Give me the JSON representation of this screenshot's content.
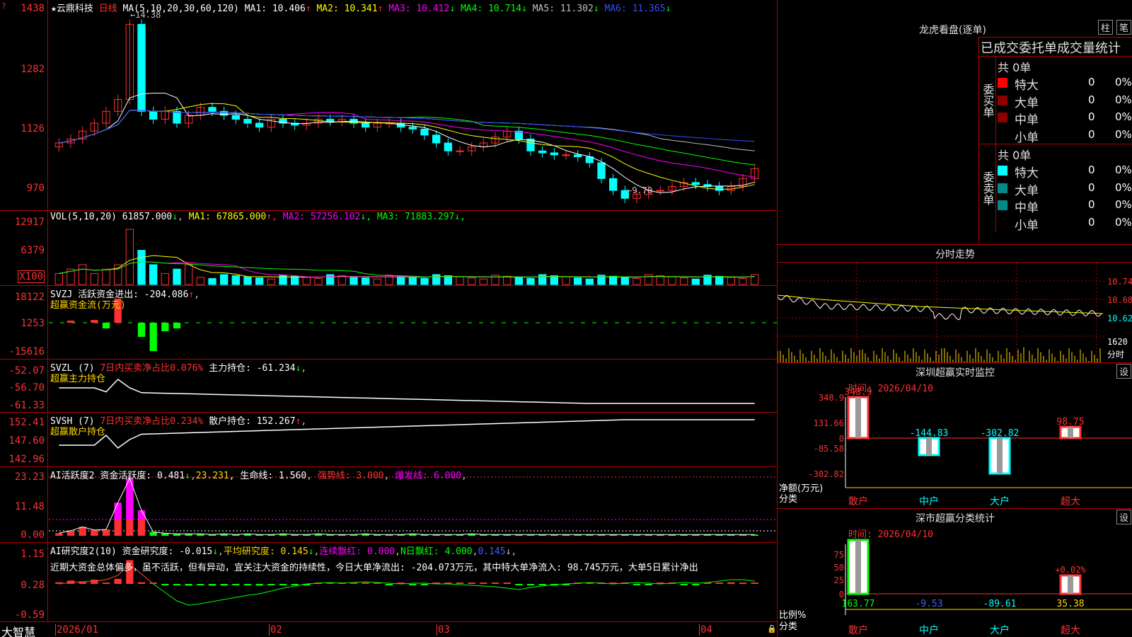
{
  "stock": {
    "name": "云鼎科技",
    "period": "日线",
    "ma_title": "MA(5,10,20,30,60,120)",
    "mas": [
      {
        "label": "MA1: 10.406",
        "arrow": "↑",
        "color": "#ffffff"
      },
      {
        "label": "MA2: 10.341",
        "arrow": "↑",
        "color": "#ffff00"
      },
      {
        "label": "MA3: 10.412",
        "arrow": "↓",
        "color": "#ff00ff"
      },
      {
        "label": "MA4: 10.714",
        "arrow": "↓",
        "color": "#00ff00"
      },
      {
        "label": "MA5: 11.302",
        "arrow": "↓",
        "color": "#c0c0c0"
      },
      {
        "label": "MA6: 11.365",
        "arrow": "↓",
        "color": "#3050ff"
      }
    ],
    "high_mark": "14.38",
    "low_mark": "9.70",
    "price_axis": [
      "1438",
      "1282",
      "1126",
      "970"
    ]
  },
  "vol": {
    "title": "VOL(5,10,20)",
    "value": "61857.000",
    "arrow": "↓",
    "mas": [
      {
        "label": "MA1: 67865.000",
        "arrow": "↑",
        "color": "#ffff00"
      },
      {
        "label": "MA2: 57256.102",
        "arrow": "↓",
        "color": "#ff00ff"
      },
      {
        "label": "MA3: 71883.297",
        "arrow": "↓",
        "color": "#00ff00"
      }
    ],
    "axis": [
      "12917",
      "6379"
    ],
    "unit": "X100"
  },
  "svzj": {
    "title": "SVZJ",
    "text": "活跃资金进出: -204.086",
    "arrow": "↑",
    "sub": "超赢资金流(万元)",
    "axis": [
      "18122",
      "1253",
      "-15616"
    ]
  },
  "svzl": {
    "title": "SVZL (7)",
    "ratio": "7日内买卖净占比0.076%",
    "hold": "主力持仓: -61.234",
    "arrow": "↓",
    "sub": "超赢主力持仓",
    "axis": [
      "-52.07",
      "-56.70",
      "-61.33"
    ]
  },
  "svsh": {
    "title": "SVSH (7)",
    "ratio": "7日内买卖净占比0.234%",
    "hold": "散户持仓: 152.267",
    "arrow": "↑",
    "sub": "超赢散户持仓",
    "axis": [
      "152.41",
      "147.60",
      "142.96"
    ]
  },
  "ai1": {
    "title": "AI活跃度2",
    "a": "资金活跃度: 0.481",
    "a_arrow": "↓",
    "b": "23.231",
    "b_arrow": ",",
    "c": "生命线: 1.560",
    "d": "强势线: 3.000",
    "e": "爆发线: 6.000",
    "axis": [
      "23.23",
      "11.48",
      "0.00"
    ]
  },
  "ai2": {
    "title": "AI研究度2(10)",
    "a": "资金研究度: -0.015",
    "a_arrow": "↓",
    "b": "平均研究度: 0.145",
    "b_arrow": "↓",
    "c": "连续飘红: 0.000",
    "d": "N日飘红: 4.000",
    "e": "0.145",
    "note": "近期大资金总体偏多，虽不活跃，但有异动，宜关注大资金的持续性，今日大单净流出: -204.073万元，其中特大单净流入: 98.745万元，大单5日累计净出",
    "axis": [
      "1.15",
      "0.28",
      "-0.59"
    ]
  },
  "dates": {
    "bottom_label": "大智慧",
    "labels": [
      "2026/01",
      "02",
      "03",
      "04"
    ]
  },
  "dragon": {
    "title": "龙虎看盘(逐单)",
    "btn1": "柱",
    "btn2": "笔",
    "header": "已成交委托单成交量统计",
    "buy": {
      "total": "共 0单",
      "side": "委买单",
      "rows": [
        {
          "name": "特大",
          "v": "0",
          "p": "0%",
          "color": "#ff0000"
        },
        {
          "name": "大单",
          "v": "0",
          "p": "0%",
          "color": "#8b0000"
        },
        {
          "name": "中单",
          "v": "0",
          "p": "0%",
          "color": "#8b0000"
        },
        {
          "name": "小单",
          "v": "0",
          "p": "0%",
          "color": ""
        }
      ]
    },
    "sell": {
      "total": "共 0单",
      "side": "委卖单",
      "rows": [
        {
          "name": "特大",
          "v": "0",
          "p": "0%",
          "color": "#00ffff"
        },
        {
          "name": "大单",
          "v": "0",
          "p": "0%",
          "color": "#008b8b"
        },
        {
          "name": "中单",
          "v": "0",
          "p": "0%",
          "color": "#008b8b"
        },
        {
          "name": "小单",
          "v": "0",
          "p": "0%",
          "color": ""
        }
      ]
    }
  },
  "intraday": {
    "title": "分时走势",
    "axis": [
      "10.74",
      "10.68",
      "10.62"
    ],
    "vol": "1620",
    "vol_unit": "分时"
  },
  "monitor": {
    "title": "深圳超赢实时监控",
    "set": "设",
    "time": "时间: 2026/04/10",
    "ylabels": [
      "348.9",
      "131.66",
      "0",
      "-85.58",
      "-302.82"
    ],
    "unit": "净额(万元)",
    "cat_label": "分类",
    "values": [
      {
        "cat": "散户",
        "v": "348.9",
        "n": 348.9,
        "catColor": "#ff3030"
      },
      {
        "cat": "中户",
        "v": "-144.83",
        "n": -144.83,
        "catColor": "#00ffff"
      },
      {
        "cat": "大户",
        "v": "-302.82",
        "n": -302.82,
        "catColor": "#00ffff"
      },
      {
        "cat": "超大",
        "v": "98.75",
        "n": 98.75,
        "catColor": "#ff3030"
      }
    ]
  },
  "classify": {
    "title": "深市超赢分类统计",
    "set": "设",
    "time": "时间: 2026/04/10",
    "ylabels": [
      "75",
      "50",
      "25",
      "0"
    ],
    "unit": "比例%",
    "cat_label": "分类",
    "extra": "+0.02%",
    "values": [
      {
        "cat": "散户",
        "v": "163.77",
        "n": 100,
        "catColor": "#ff3030",
        "valColor": "#00ff00"
      },
      {
        "cat": "中户",
        "v": "-9.53",
        "n": 0,
        "catColor": "#00ffff",
        "valColor": "#4060ff"
      },
      {
        "cat": "大户",
        "v": "-89.61",
        "n": 0,
        "catColor": "#00ffff",
        "valColor": "#00ffff"
      },
      {
        "cat": "超大",
        "v": "35.38",
        "n": 35,
        "catColor": "#ff3030",
        "valColor": "#ffd700"
      }
    ]
  }
}
